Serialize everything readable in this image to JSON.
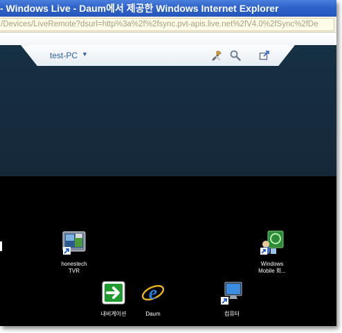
{
  "window": {
    "title": "- Windows Live - Daum에서 제공한 Windows Internet Explorer"
  },
  "address_bar": {
    "url": "/Devices/LiveRemote?dsurl=http%3a%2f%2fsync.pvt-apis.live.net%2fV4.0%2fSync%2fDe"
  },
  "header": {
    "device_name": "test-PC",
    "device_caret": "▼",
    "tools": [
      {
        "icon": "tools-icon"
      },
      {
        "icon": "search-icon"
      },
      {
        "icon": "popout-icon"
      }
    ]
  },
  "desktop": {
    "icons": [
      {
        "name": "honestech TVR",
        "label_line1": "honestech",
        "label_line2": "TVR",
        "icon": "honestech-tvr-icon"
      },
      {
        "name": "Windows Mobile",
        "label_line1": "Windows",
        "label_line2": "Mobile 회...",
        "icon": "windows-mobile-icon"
      },
      {
        "name": "내비게이션",
        "label_line1": "내비게이션",
        "icon": "navigation-icon"
      },
      {
        "name": "Daum",
        "label_line1": "Daum",
        "icon": "internet-explorer-icon"
      },
      {
        "name": "컴퓨터",
        "label_line1": "컴퓨터",
        "icon": "computer-icon"
      }
    ]
  },
  "colors": {
    "titlebar": "#2f62c9",
    "header_bg": "#162b3d",
    "tab_text": "#2b5ea4",
    "desktop_bg": "#000000"
  }
}
